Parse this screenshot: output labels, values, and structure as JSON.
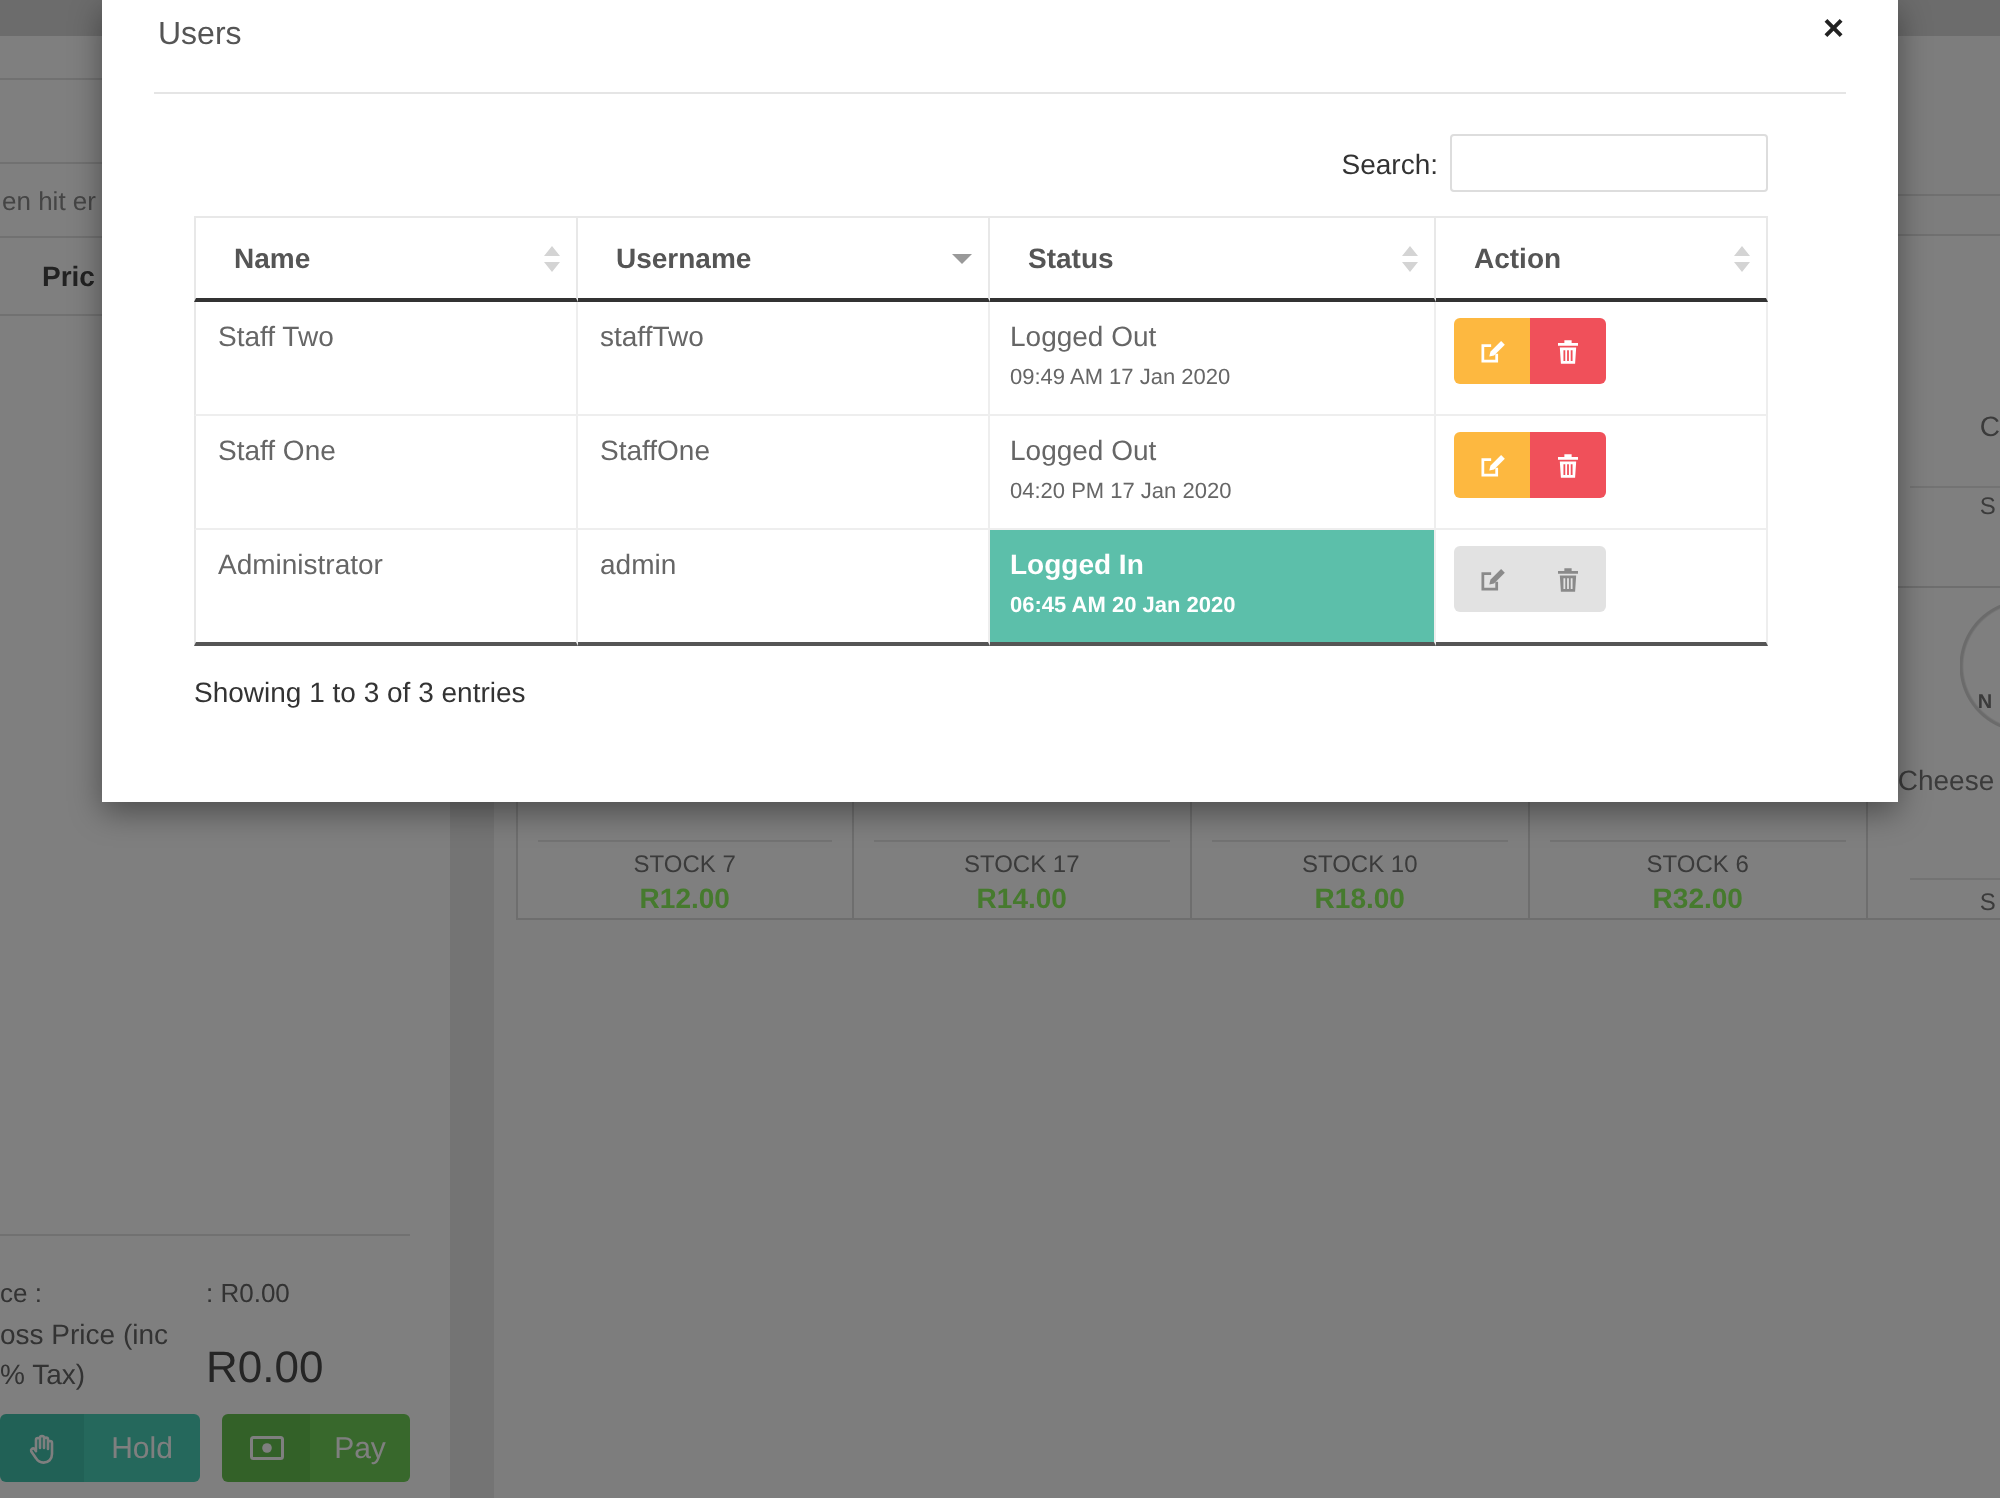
{
  "background": {
    "left_panel": {
      "instruction": "en hit er",
      "column_header": "Pric",
      "subtotal": {
        "label": "ce :",
        "value": ": R0.00"
      },
      "gross": {
        "label_lines": [
          "oss Price (inc",
          "% Tax)"
        ],
        "value": "R0.00"
      },
      "buttons": [
        {
          "kind": "hold",
          "label": "Hold"
        },
        {
          "kind": "pay",
          "label": "Pay"
        }
      ]
    },
    "products": {
      "cards": [
        {
          "stock": "STOCK 7",
          "price": "R12.00"
        },
        {
          "stock": "STOCK 17",
          "price": "R14.00"
        },
        {
          "stock": "STOCK 10",
          "price": "R18.00"
        },
        {
          "stock": "STOCK 6",
          "price": "R32.00"
        }
      ],
      "edge_cards": [
        {
          "name": "C",
          "stock": "S"
        },
        {
          "image_text": "N",
          "name": "Cheese",
          "stock": "S"
        }
      ]
    }
  },
  "modal": {
    "title": "Users",
    "close": "×",
    "search": {
      "label": "Search:"
    },
    "table": {
      "columns": [
        {
          "label": "Name",
          "sorted": false
        },
        {
          "label": "Username",
          "sorted": true
        },
        {
          "label": "Status",
          "sorted": false
        },
        {
          "label": "Action",
          "sorted": false
        }
      ],
      "rows": [
        {
          "name": "Staff Two",
          "username": "staffTwo",
          "status": "Logged Out",
          "time": "09:49 AM 17 Jan 2020",
          "logged_in": false,
          "actions_disabled": false
        },
        {
          "name": "Staff One",
          "username": "StaffOne",
          "status": "Logged Out",
          "time": "04:20 PM 17 Jan 2020",
          "logged_in": false,
          "actions_disabled": false
        },
        {
          "name": "Administrator",
          "username": "admin",
          "status": "Logged In",
          "time": "06:45 AM 20 Jan 2020",
          "logged_in": true,
          "actions_disabled": true
        }
      ]
    },
    "info": "Showing 1 to 3 of 3 entries"
  }
}
